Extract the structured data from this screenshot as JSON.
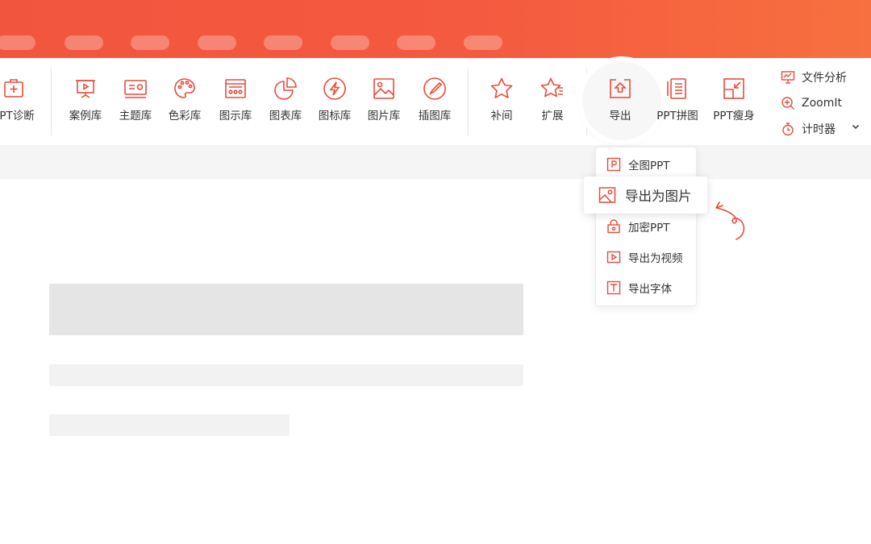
{
  "colors": {
    "accent": "#e94b3c",
    "tabbar_start": "#f2553e",
    "tabbar_end": "#f7703f"
  },
  "tabbar": {
    "tab_count": 8
  },
  "ribbon": {
    "tools": [
      {
        "label": "PPT诊断",
        "icon": "diagnosis-icon"
      },
      {
        "label": "案例库",
        "icon": "case-library-icon"
      },
      {
        "label": "主题库",
        "icon": "theme-library-icon"
      },
      {
        "label": "色彩库",
        "icon": "palette-icon"
      },
      {
        "label": "图示库",
        "icon": "diagram-library-icon"
      },
      {
        "label": "图表库",
        "icon": "chart-library-icon"
      },
      {
        "label": "图标库",
        "icon": "icon-library-icon"
      },
      {
        "label": "图片库",
        "icon": "image-library-icon"
      },
      {
        "label": "插图库",
        "icon": "illustration-library-icon"
      },
      {
        "label": "补间",
        "icon": "tween-star-icon"
      },
      {
        "label": "扩展",
        "icon": "extend-star-icon"
      },
      {
        "label": "导出",
        "icon": "export-icon"
      },
      {
        "label": "PPT拼图",
        "icon": "collage-icon"
      },
      {
        "label": "PPT瘦身",
        "icon": "slim-icon"
      }
    ],
    "side": [
      {
        "label": "文件分析",
        "icon": "file-analysis-icon"
      },
      {
        "label": "ZoomIt",
        "icon": "zoom-in-icon"
      },
      {
        "label": "计时器",
        "icon": "timer-icon"
      }
    ]
  },
  "dropdown": {
    "items": [
      {
        "label": "全图PPT",
        "icon": "p-square-icon"
      },
      {
        "label": "导出为图片",
        "icon": "picture-icon"
      },
      {
        "label": "加密PPT",
        "icon": "lock-icon"
      },
      {
        "label": "导出为视频",
        "icon": "video-icon"
      },
      {
        "label": "导出字体",
        "icon": "font-t-icon"
      }
    ]
  }
}
